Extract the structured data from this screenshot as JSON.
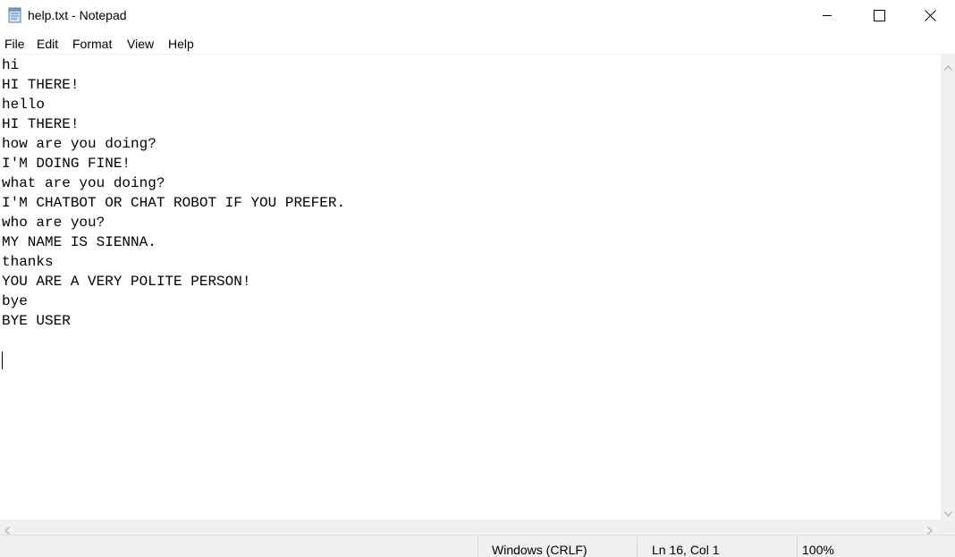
{
  "window": {
    "title": "help.txt - Notepad",
    "icon": "notepad-icon",
    "controls": [
      "minimize-icon",
      "maximize-icon",
      "close-icon"
    ]
  },
  "menu": {
    "items": [
      "File",
      "Edit",
      "Format",
      "View",
      "Help"
    ]
  },
  "editor": {
    "lines": [
      "hi",
      "HI THERE!",
      "hello",
      "HI THERE!",
      "how are you doing?",
      "I'M DOING FINE!",
      "what are you doing?",
      "I'M CHATBOT OR CHAT ROBOT IF YOU PREFER.",
      "who are you?",
      "MY NAME IS SIENNA.",
      "thanks",
      "YOU ARE A VERY POLITE PERSON!",
      "bye",
      "BYE USER",
      "",
      ""
    ]
  },
  "statusbar": {
    "encoding": "Windows (CRLF)",
    "position": "Ln 16, Col 1",
    "zoom": "100%"
  }
}
